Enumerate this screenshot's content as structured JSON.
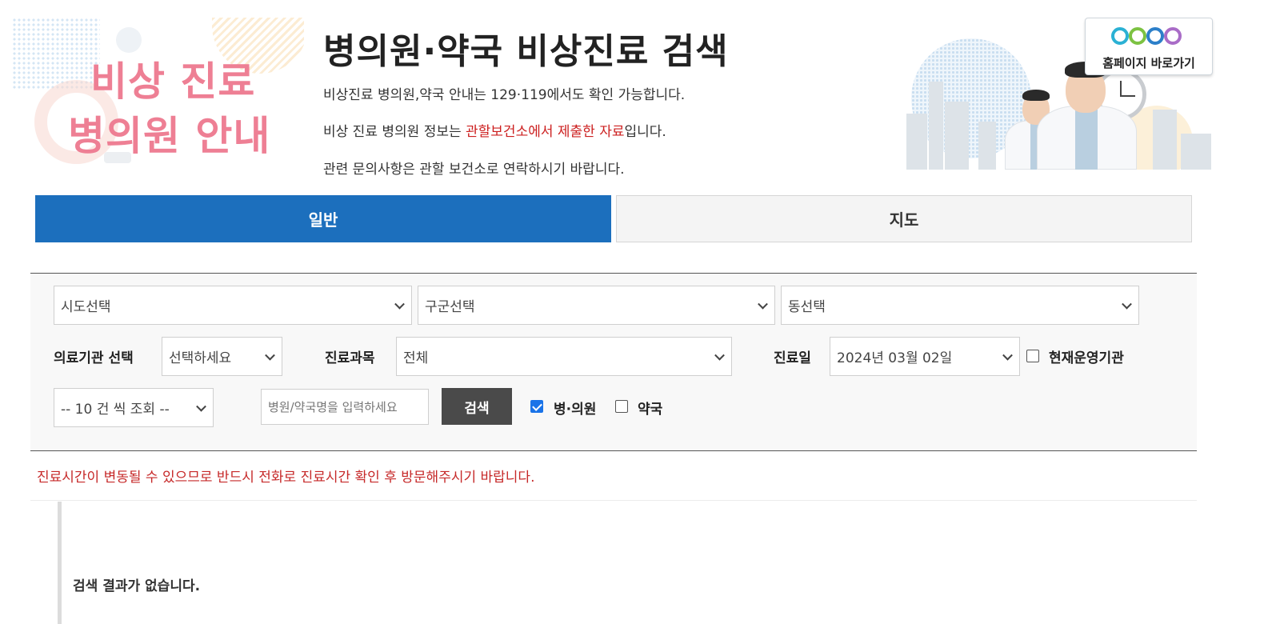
{
  "banner": {
    "line1": "비상 진료",
    "line2": "병의원 안내"
  },
  "header": {
    "title": "병의원·약국 비상진료 검색",
    "info1": "비상진료 병의원,약국 안내는 129·119에서도 확인 가능합니다.",
    "info2_pre": "비상 진료 병의원 정보는 ",
    "info2_red": "관할보건소에서 제출한 자료",
    "info2_post": "입니다.",
    "info3": "관련 문의사항은 관할 보건소로 연락하시기 바랍니다."
  },
  "homepage_button": {
    "label": "홈페이지 바로가기"
  },
  "tabs": [
    {
      "label": "일반",
      "active": true
    },
    {
      "label": "지도",
      "active": false
    }
  ],
  "filters": {
    "sido": "시도선택",
    "gugun": "구군선택",
    "dong": "동선택",
    "facility_label": "의료기관 선택",
    "facility_value": "선택하세요",
    "dept_label": "진료과목",
    "dept_value": "전체",
    "date_label": "진료일",
    "date_value": "2024년 03월 02일",
    "operating_label": "현재운영기관",
    "operating_checked": false,
    "page_size": "-- 10 건 씩 조회 --",
    "name_placeholder": "병원/약국명을 입력하세요",
    "search_label": "검색",
    "hospital_label": "병·의원",
    "hospital_checked": true,
    "pharmacy_label": "약국",
    "pharmacy_checked": false
  },
  "notice": "진료시간이 변동될 수 있으므로 반드시 전화로 진료시간 확인 후 방문해주시기 바랍니다.",
  "results": {
    "empty_message": "검색 결과가 없습니다."
  },
  "colors": {
    "accent": "#1c6fbd",
    "notice": "#c62828",
    "banner_pink": "#ee7f94"
  }
}
